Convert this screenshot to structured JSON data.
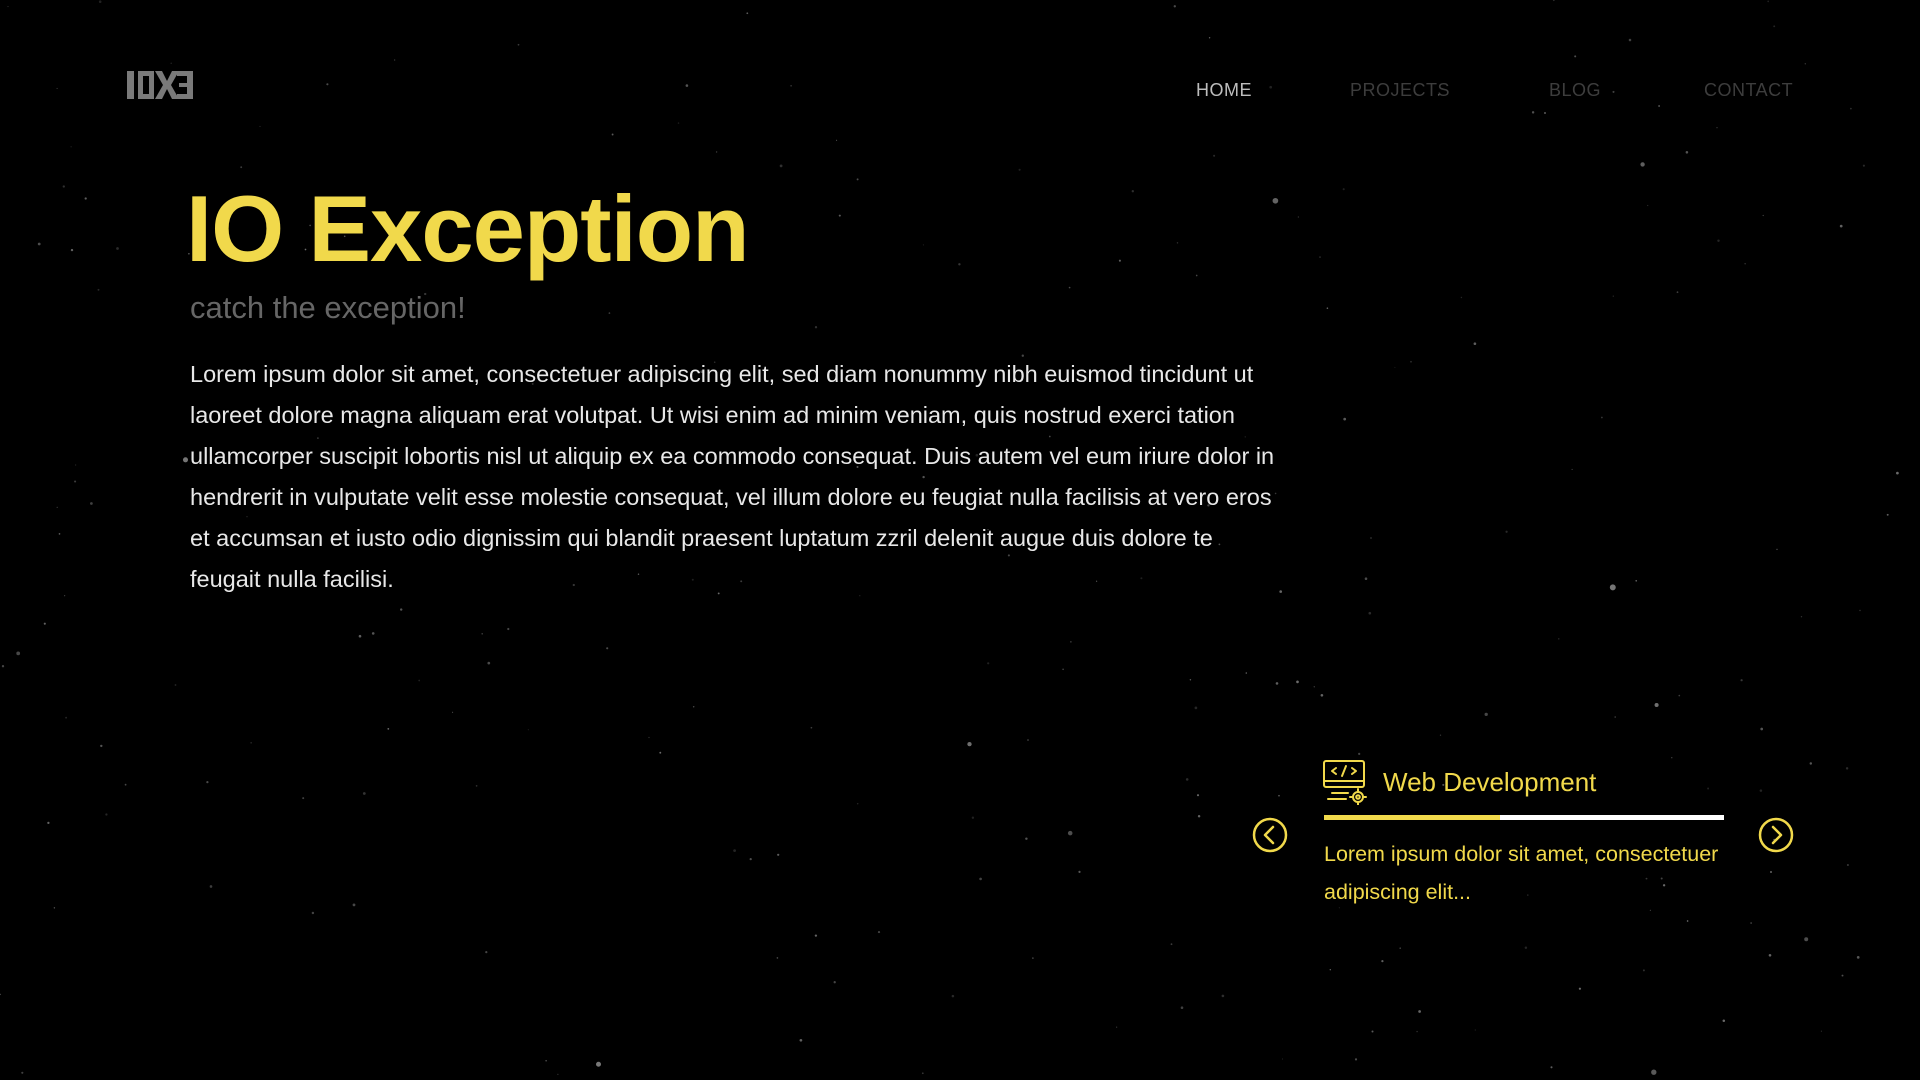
{
  "logo": {
    "text": "IOXE"
  },
  "nav": {
    "items": [
      {
        "label": "HOME",
        "active": true
      },
      {
        "label": "PROJECTS",
        "active": false
      },
      {
        "label": "BLOG",
        "active": false
      },
      {
        "label": "CONTACT",
        "active": false
      }
    ]
  },
  "hero": {
    "title": "IO Exception",
    "subtitle": "catch the exception!",
    "body": "Lorem ipsum dolor sit amet, consectetuer adipiscing elit, sed diam nonummy nibh euismod tincidunt ut laoreet dolore magna aliquam erat volutpat. Ut wisi enim ad minim veniam, quis nostrud exerci tation ullamcorper suscipit lobortis nisl ut aliquip ex ea commodo consequat. Duis autem vel eum iriure dolor in hendrerit in vulputate velit esse molestie consequat, vel illum dolore eu feugiat nulla facilisis at vero eros et accumsan et iusto odio dignissim qui blandit praesent luptatum zzril delenit augue duis dolore te feugait nulla facilisi."
  },
  "slider": {
    "icon": "web-development-icon",
    "title": "Web Development",
    "description": "Lorem ipsum dolor sit amet, consectetuer adipiscing elit...",
    "progress": 0.44,
    "prev_icon": "chevron-left-circle-icon",
    "next_icon": "chevron-right-circle-icon"
  },
  "colors": {
    "background": "#000000",
    "accent": "#f1d94b",
    "nav_active": "#bdbdbd",
    "nav_inactive": "#3d3d3d",
    "subtitle": "#666666",
    "body_text": "#e8e8e8",
    "logo": "#7a7a7a"
  }
}
